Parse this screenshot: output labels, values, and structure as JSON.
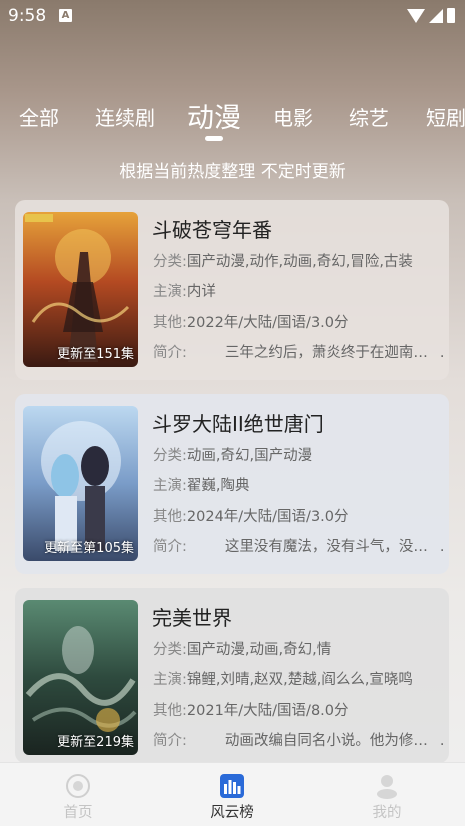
{
  "status": {
    "time": "9:58",
    "notif": "A"
  },
  "tabs": [
    {
      "label": "全部",
      "active": false
    },
    {
      "label": "连续剧",
      "active": false
    },
    {
      "label": "动漫",
      "active": true
    },
    {
      "label": "电影",
      "active": false
    },
    {
      "label": "综艺",
      "active": false
    },
    {
      "label": "短剧",
      "active": false
    }
  ],
  "subtitle": "根据当前热度整理 不定时更新",
  "labels": {
    "category": "分类:",
    "cast": "主演:",
    "other": "其他:",
    "intro": "简介:"
  },
  "cards": [
    {
      "title": "斗破苍穹年番",
      "category": "国产动漫,动作,动画,奇幻,冒险,古装",
      "cast": "内详",
      "other": "2022年/大陆/国语/3.0分",
      "intro": "三年之约后，萧炎终于在迦南学院见到了",
      "badge": "更新至151集"
    },
    {
      "title": "斗罗大陆II绝世唐门",
      "category": "动画,奇幻,国产动漫",
      "cast": "翟巍,陶典",
      "other": "2024年/大陆/国语/3.0分",
      "intro": "这里没有魔法，没有斗气，没有武术",
      "badge": "更新至第105集"
    },
    {
      "title": "完美世界",
      "category": "国产动漫,动画,奇幻,情",
      "cast": "锦鲤,刘晴,赵双,楚越,阎么么,宣晓鸣",
      "other": "2021年/大陆/国语/8.0分",
      "intro": "动画改编自同名小说。他为修炼而生",
      "badge": "更新至219集"
    }
  ],
  "nav": {
    "home": "首页",
    "rank": "风云榜",
    "mine": "我的"
  },
  "colors": {
    "active_nav": "#333333",
    "inactive_nav": "#c4c4c4",
    "rank_icon": "#2a6ad8"
  }
}
